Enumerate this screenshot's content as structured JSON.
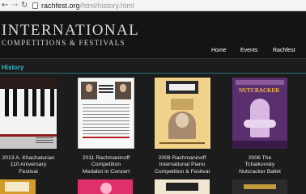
{
  "browser": {
    "url_host": "rachfest.org",
    "url_path": "/html/history.html"
  },
  "header": {
    "logo_line1": "INTERNATIONAL",
    "logo_line2": "COMPETITIONS & FESTIVALS",
    "nav": [
      "Home",
      "Events",
      "Rachfest"
    ]
  },
  "section_title": "History",
  "posters": [
    {
      "caption_lines": [
        "2013 A. Khachaturian",
        "110 Aniversary",
        "Festival"
      ]
    },
    {
      "caption_lines": [
        "2011 Rachmaninoff",
        "Competition",
        "Medalist in Concert"
      ]
    },
    {
      "caption_lines": [
        "2008 Rachmaninoff",
        "International Piano",
        "Competition & Festival"
      ]
    },
    {
      "caption_lines": [
        "2006 The",
        "Tchaikovsky",
        "Nutcracker Ballet"
      ]
    }
  ],
  "poster_texts": {
    "nutcracker": "NUTCRACKER"
  },
  "colors": {
    "accent": "#2bbcc6",
    "background": "#1c1c1c"
  }
}
